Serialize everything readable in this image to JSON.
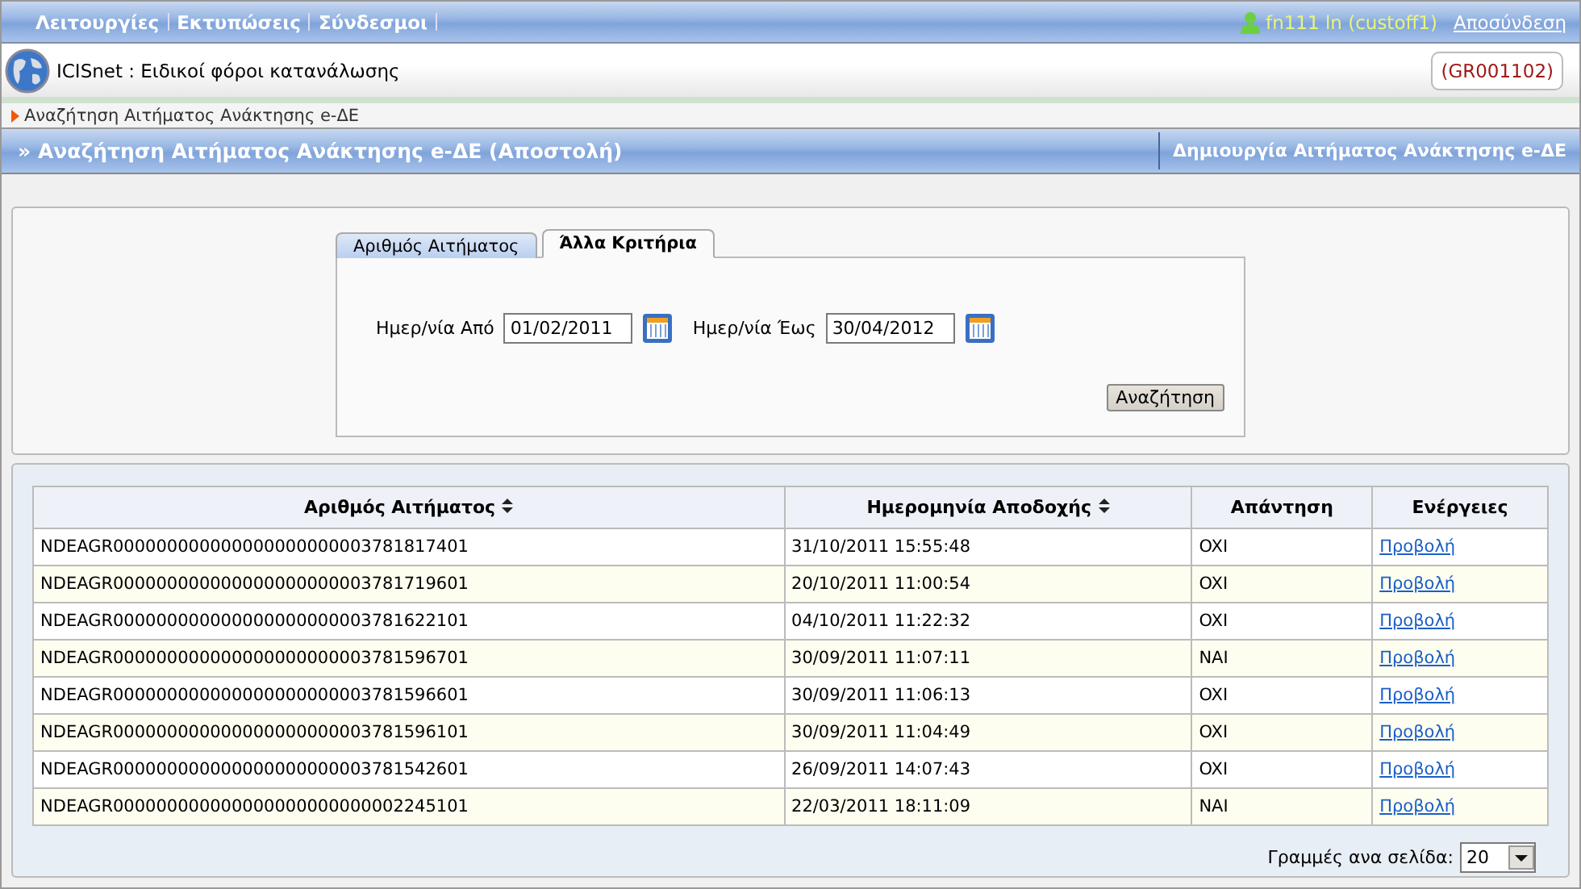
{
  "nav": {
    "menus": [
      "Λειτουργίες",
      "Εκτυπώσεις",
      "Σύνδεσμοι"
    ],
    "user": "fn111 ln (custoff1)",
    "logout": "Αποσύνδεση"
  },
  "header": {
    "app_title": "ICISnet : Ειδικοί φόροι κατανάλωσης",
    "office_code": "(GR001102)"
  },
  "breadcrumb": "Αναζήτηση Αιτήματος Ανάκτησης e-ΔΕ",
  "title_bar": {
    "marker": "»",
    "title": "Αναζήτηση Αιτήματος Ανάκτησης e-ΔΕ (Αποστολή)",
    "action": "Δημιουργία Αιτήματος Ανάκτησης e-ΔΕ"
  },
  "search": {
    "tabs": [
      {
        "label": "Αριθμός Αιτήματος",
        "selected": false
      },
      {
        "label": "Άλλα Κριτήρια",
        "selected": true
      }
    ],
    "fields": [
      {
        "label": "Ημερ/νία Από",
        "value": "01/02/2011"
      },
      {
        "label": "Ημερ/νία Έως",
        "value": "30/04/2012"
      }
    ],
    "button": "Αναζήτηση"
  },
  "table": {
    "columns": [
      {
        "label": "Αριθμός Αιτήματος",
        "sortable": true
      },
      {
        "label": "Ημερομηνία Αποδοχής",
        "sortable": true
      },
      {
        "label": "Απάντηση",
        "sortable": false
      },
      {
        "label": "Ενέργειες",
        "sortable": false
      }
    ],
    "rows": [
      [
        "NDEAGR000000000000000000000003781817401",
        "31/10/2011 15:55:48",
        "OXI",
        "Προβολή"
      ],
      [
        "NDEAGR000000000000000000000003781719601",
        "20/10/2011 11:00:54",
        "OXI",
        "Προβολή"
      ],
      [
        "NDEAGR000000000000000000000003781622101",
        "04/10/2011 11:22:32",
        "OXI",
        "Προβολή"
      ],
      [
        "NDEAGR000000000000000000000003781596701",
        "30/09/2011 11:07:11",
        "NAI",
        "Προβολή"
      ],
      [
        "NDEAGR000000000000000000000003781596601",
        "30/09/2011 11:06:13",
        "OXI",
        "Προβολή"
      ],
      [
        "NDEAGR000000000000000000000003781596101",
        "30/09/2011 11:04:49",
        "OXI",
        "Προβολή"
      ],
      [
        "NDEAGR000000000000000000000003781542601",
        "26/09/2011 14:07:43",
        "OXI",
        "Προβολή"
      ],
      [
        "NDEAGR000000000000000000000000002245101",
        "22/03/2011 18:11:09",
        "NAI",
        "Προβολή"
      ]
    ]
  },
  "pagination": {
    "label": "Γραμμές ανα σελίδα:",
    "value": "20"
  }
}
